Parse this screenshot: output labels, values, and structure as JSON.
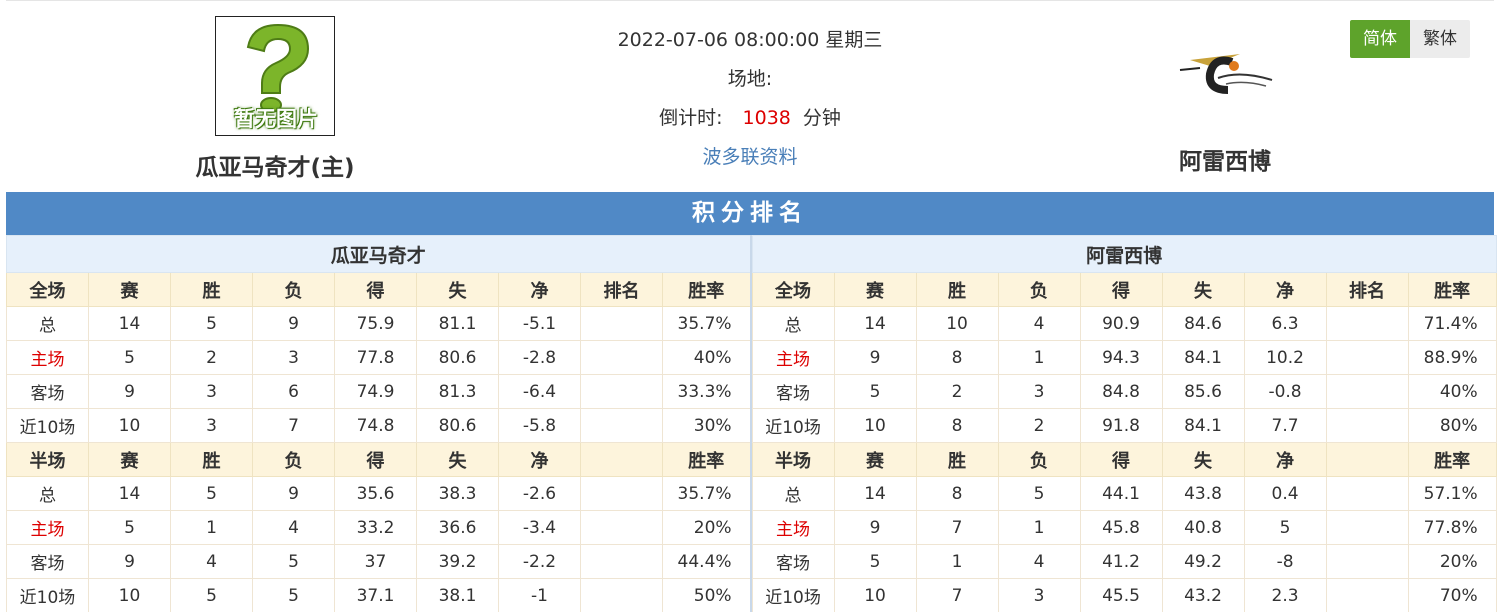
{
  "match": {
    "datetime": "2022-07-06 08:00:00 星期三",
    "venue_label": "场地:",
    "countdown_label": "倒计时:",
    "countdown_value": "1038",
    "countdown_unit": "分钟",
    "info_link": "波多联资料"
  },
  "home_team": {
    "name": "瓜亚马奇才(主)",
    "logo_text": "暂无图片"
  },
  "away_team": {
    "name": "阿雷西博"
  },
  "lang": {
    "simplified": "简体",
    "traditional": "繁体"
  },
  "standings": {
    "title": "积分排名",
    "left": {
      "team": "瓜亚马奇才",
      "full_header": [
        "全场",
        "赛",
        "胜",
        "负",
        "得",
        "失",
        "净",
        "排名",
        "胜率"
      ],
      "full_rows": [
        [
          "总",
          "14",
          "5",
          "9",
          "75.9",
          "81.1",
          "-5.1",
          "",
          "35.7%"
        ],
        [
          "主场",
          "5",
          "2",
          "3",
          "77.8",
          "80.6",
          "-2.8",
          "",
          "40%"
        ],
        [
          "客场",
          "9",
          "3",
          "6",
          "74.9",
          "81.3",
          "-6.4",
          "",
          "33.3%"
        ],
        [
          "近10场",
          "10",
          "3",
          "7",
          "74.8",
          "80.6",
          "-5.8",
          "",
          "30%"
        ]
      ],
      "half_header": [
        "半场",
        "赛",
        "胜",
        "负",
        "得",
        "失",
        "净",
        "",
        "胜率"
      ],
      "half_rows": [
        [
          "总",
          "14",
          "5",
          "9",
          "35.6",
          "38.3",
          "-2.6",
          "",
          "35.7%"
        ],
        [
          "主场",
          "5",
          "1",
          "4",
          "33.2",
          "36.6",
          "-3.4",
          "",
          "20%"
        ],
        [
          "客场",
          "9",
          "4",
          "5",
          "37",
          "39.2",
          "-2.2",
          "",
          "44.4%"
        ],
        [
          "近10场",
          "10",
          "5",
          "5",
          "37.1",
          "38.1",
          "-1",
          "",
          "50%"
        ]
      ]
    },
    "right": {
      "team": "阿雷西博",
      "full_header": [
        "全场",
        "赛",
        "胜",
        "负",
        "得",
        "失",
        "净",
        "排名",
        "胜率"
      ],
      "full_rows": [
        [
          "总",
          "14",
          "10",
          "4",
          "90.9",
          "84.6",
          "6.3",
          "",
          "71.4%"
        ],
        [
          "主场",
          "9",
          "8",
          "1",
          "94.3",
          "84.1",
          "10.2",
          "",
          "88.9%"
        ],
        [
          "客场",
          "5",
          "2",
          "3",
          "84.8",
          "85.6",
          "-0.8",
          "",
          "40%"
        ],
        [
          "近10场",
          "10",
          "8",
          "2",
          "91.8",
          "84.1",
          "7.7",
          "",
          "80%"
        ]
      ],
      "half_header": [
        "半场",
        "赛",
        "胜",
        "负",
        "得",
        "失",
        "净",
        "",
        "胜率"
      ],
      "half_rows": [
        [
          "总",
          "14",
          "8",
          "5",
          "44.1",
          "43.8",
          "0.4",
          "",
          "57.1%"
        ],
        [
          "主场",
          "9",
          "7",
          "1",
          "45.8",
          "40.8",
          "5",
          "",
          "77.8%"
        ],
        [
          "客场",
          "5",
          "1",
          "4",
          "41.2",
          "49.2",
          "-8",
          "",
          "20%"
        ],
        [
          "近10场",
          "10",
          "7",
          "3",
          "45.5",
          "43.2",
          "2.3",
          "",
          "70%"
        ]
      ]
    }
  },
  "colors": {
    "accent_blue": "#5089c6",
    "home_red": "#dd0000",
    "toggle_green": "#5ea32b"
  }
}
